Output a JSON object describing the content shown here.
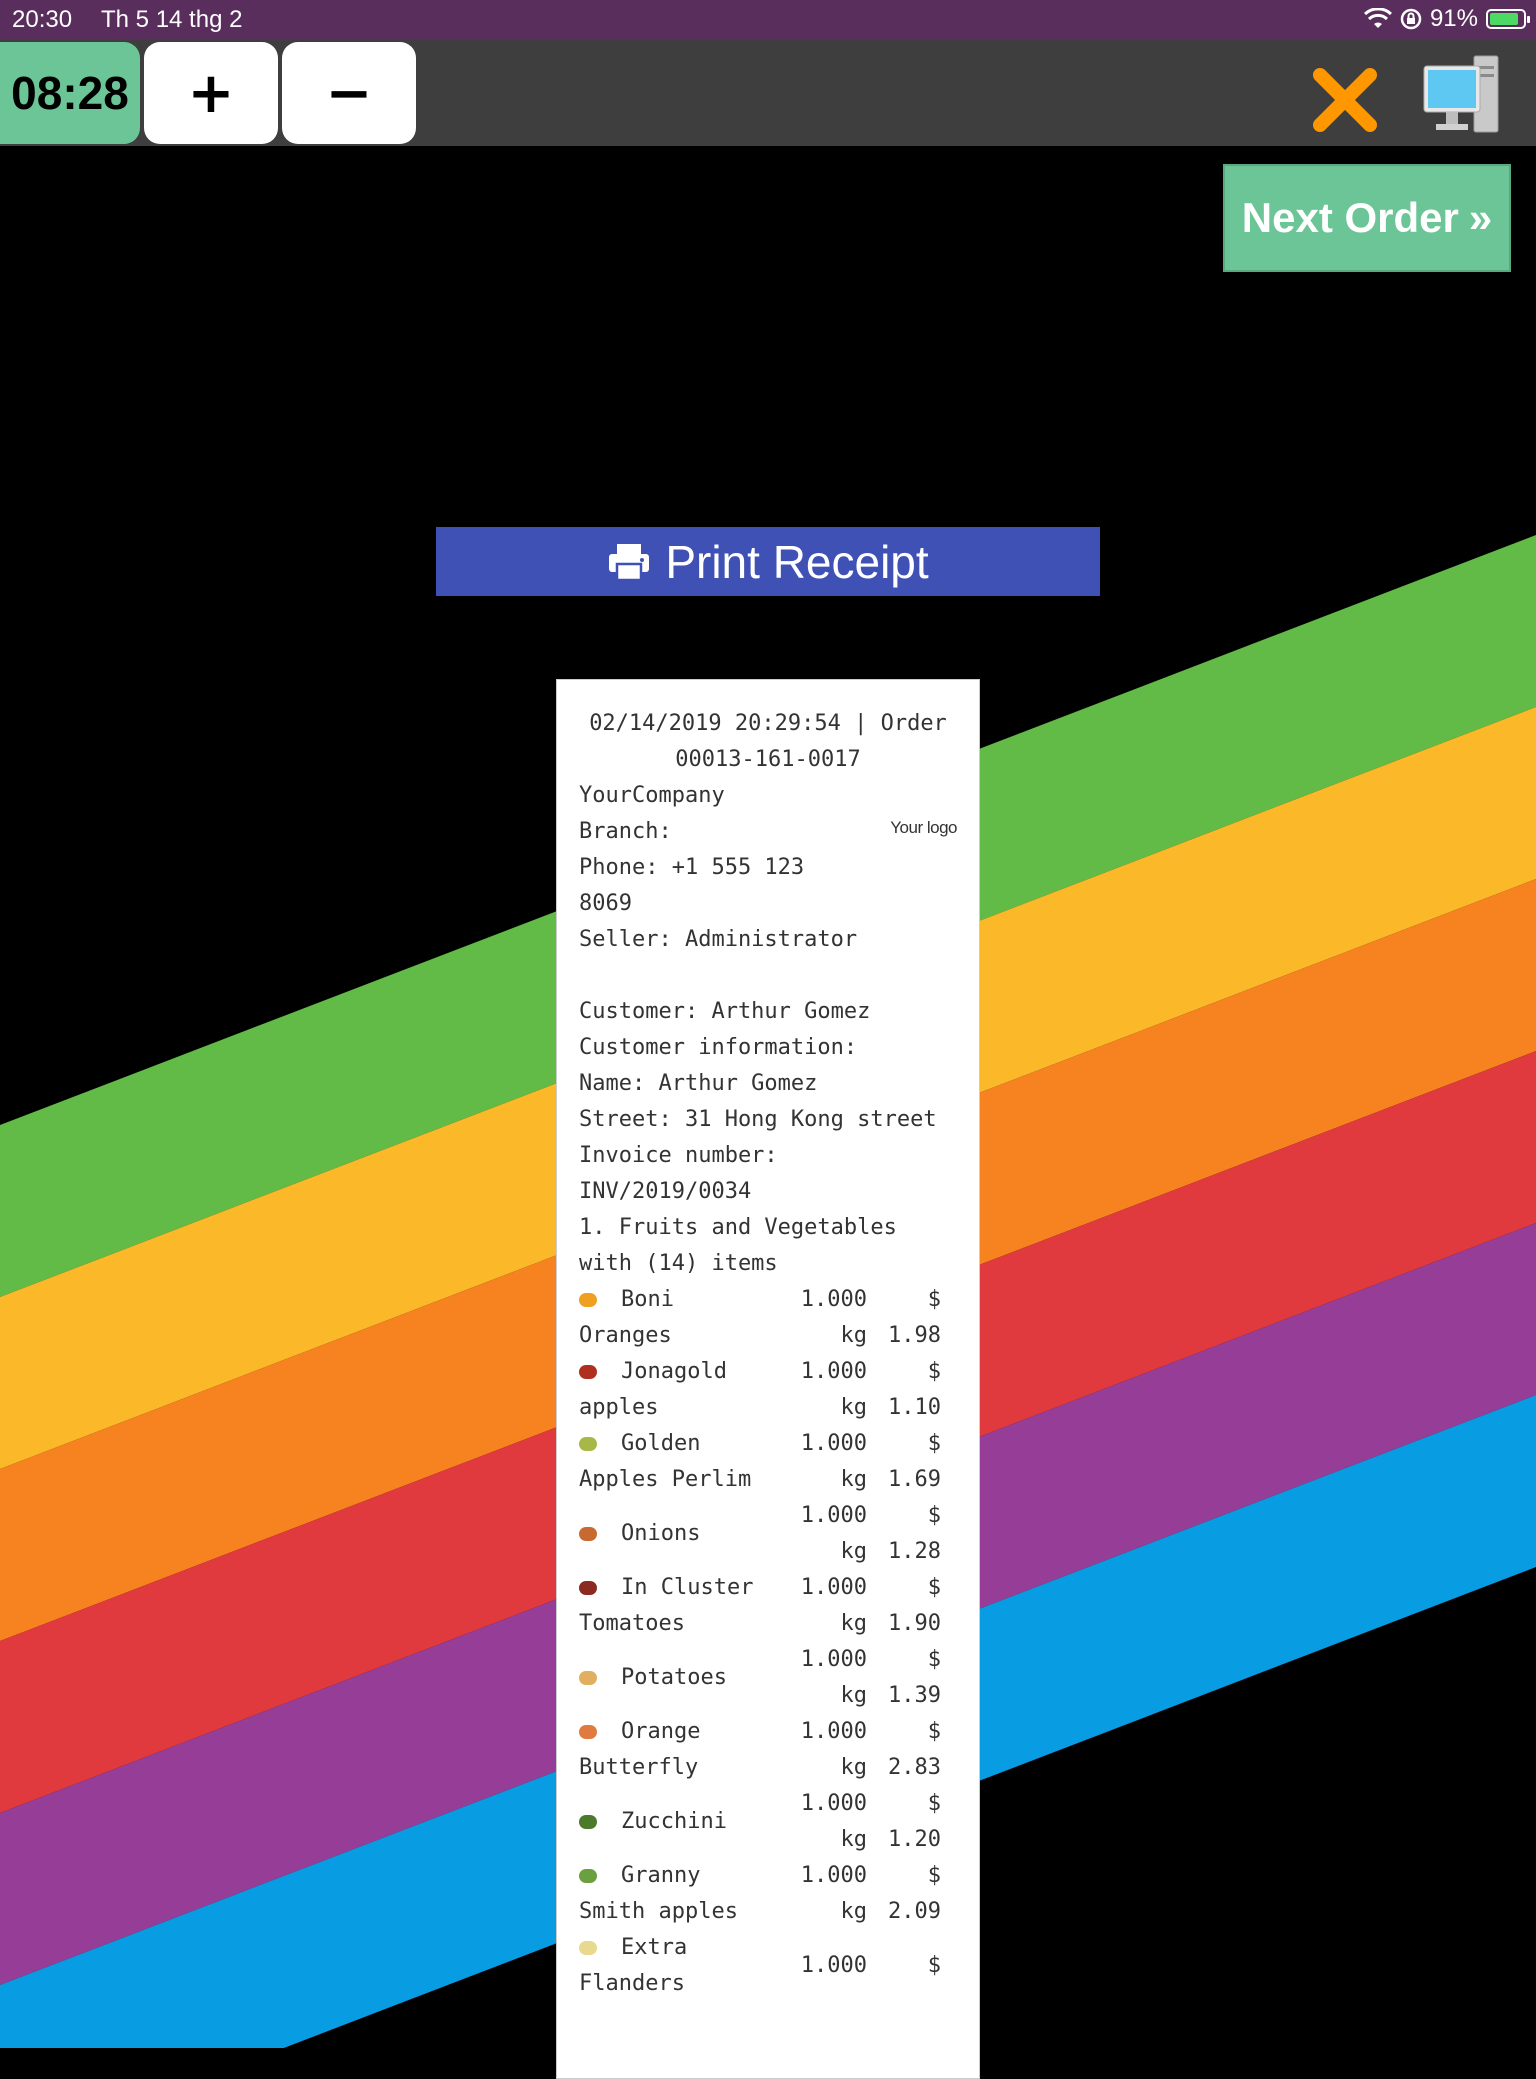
{
  "statusbar": {
    "time": "20:30",
    "date": "Th 5 14 thg 2",
    "battery_pct": "91%",
    "battery_level": 0.91
  },
  "toolbar": {
    "clock": "08:28",
    "plus": "+",
    "minus": "−"
  },
  "next_order": {
    "label": "Next Order",
    "chevron": "»"
  },
  "print": {
    "label": "Print Receipt",
    "icon": "printer-icon"
  },
  "receipt": {
    "header_line1": "02/14/2019 20:29:54 | Order",
    "header_line2": "00013-161-0017",
    "company": "YourCompany",
    "branch": "Branch:",
    "phone_line1": "Phone: +1 555 123",
    "phone_line2": "8069",
    "seller": "Seller: Administrator",
    "logo_text": "Your logo",
    "customer": "Customer: Arthur Gomez",
    "customer_info": "Customer information:",
    "name": "Name: Arthur Gomez",
    "street": "Street: 31 Hong Kong street",
    "invoice_label": "Invoice number:",
    "invoice_number": "INV/2019/0034",
    "category_line1": "1. Fruits and Vegetables",
    "category_line2": "with (14) items",
    "items": [
      {
        "name": "Boni Oranges",
        "qty": "1.000 kg",
        "price": "$ 1.98",
        "icon_color": "#f0a020"
      },
      {
        "name": "Jonagold apples",
        "qty": "1.000 kg",
        "price": "$ 1.10",
        "icon_color": "#b03020"
      },
      {
        "name": "Golden Apples Perlim",
        "qty": "1.000 kg",
        "price": "$ 1.69",
        "icon_color": "#a8b848"
      },
      {
        "name": "Onions",
        "qty": "1.000 kg",
        "price": "$ 1.28",
        "icon_color": "#c86a30"
      },
      {
        "name": "In Cluster Tomatoes",
        "qty": "1.000 kg",
        "price": "$ 1.90",
        "icon_color": "#8a2a20"
      },
      {
        "name": "Potatoes",
        "qty": "1.000 kg",
        "price": "$ 1.39",
        "icon_color": "#e0b060"
      },
      {
        "name": "Orange Butterfly",
        "qty": "1.000 kg",
        "price": "$ 2.83",
        "icon_color": "#e07a40"
      },
      {
        "name": "Zucchini",
        "qty": "1.000 kg",
        "price": "$ 1.20",
        "icon_color": "#4a7a2a"
      },
      {
        "name": "Granny Smith apples",
        "qty": "1.000 kg",
        "price": "$ 2.09",
        "icon_color": "#6aa040"
      },
      {
        "name": "Extra Flanders",
        "qty": "1.000",
        "price": "$",
        "icon_color": "#e8d890"
      }
    ]
  },
  "colors": {
    "status_bg": "#5a2e5c",
    "toolbar_bg": "#3e3e3e",
    "accent_green": "#6cc596",
    "print_blue": "#3f51b5",
    "stripe_green": "#62bb46",
    "stripe_yellow": "#fbb829",
    "stripe_orange": "#f68220",
    "stripe_red": "#e03a3e",
    "stripe_purple": "#963d97",
    "stripe_blue": "#089de2"
  }
}
